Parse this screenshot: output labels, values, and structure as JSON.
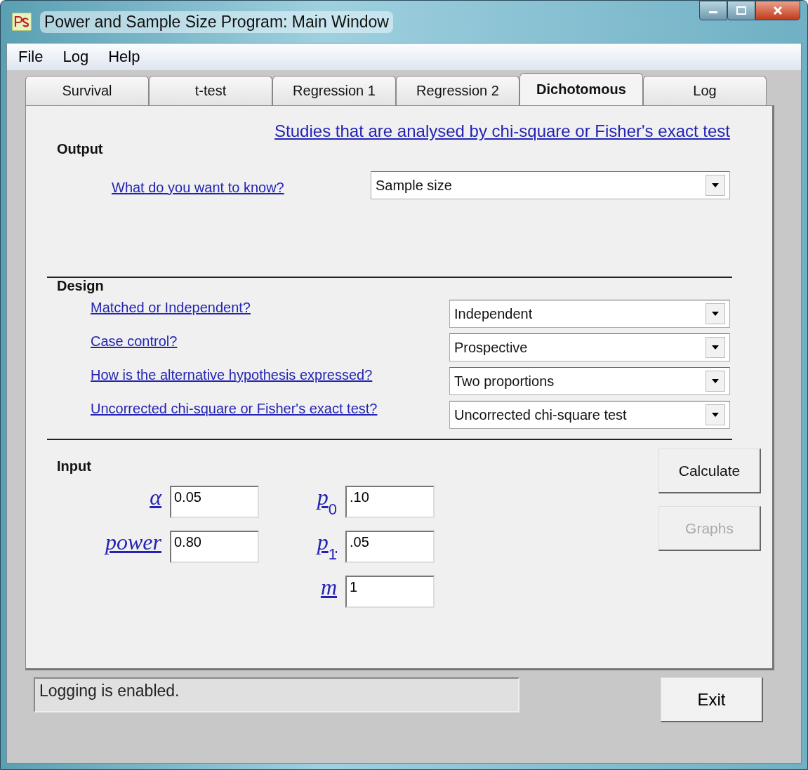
{
  "window": {
    "title": "Power and Sample Size Program:  Main Window"
  },
  "menu": [
    "File",
    "Log",
    "Help"
  ],
  "tabs": [
    {
      "label": "Survival",
      "selected": false
    },
    {
      "label": "t-test",
      "selected": false
    },
    {
      "label": "Regression 1",
      "selected": false
    },
    {
      "label": "Regression 2",
      "selected": false
    },
    {
      "label": "Dichotomous",
      "selected": true
    },
    {
      "label": "Log",
      "selected": false
    }
  ],
  "panel": {
    "title_link": "Studies that are analysed by chi-square or Fisher's exact test",
    "output": {
      "heading": "Output",
      "question": "What do you want to know?",
      "value": "Sample size"
    },
    "design": {
      "heading": "Design",
      "rows": [
        {
          "question": "Matched or Independent?",
          "value": "Independent"
        },
        {
          "question": "Case control?",
          "value": "Prospective"
        },
        {
          "question": "How is the alternative hypothesis expressed?",
          "value": "Two proportions"
        },
        {
          "question": "Uncorrected chi-square or Fisher's exact test?",
          "value": "Uncorrected chi-square test"
        }
      ]
    },
    "input": {
      "heading": "Input",
      "left": [
        {
          "label": "α",
          "value": "0.05"
        },
        {
          "label": "power",
          "value": "0.80"
        }
      ],
      "right": [
        {
          "label": "p$_{0}$",
          "value": ".10"
        },
        {
          "label": "p$_{1}$",
          "value": ".05"
        },
        {
          "label": "m",
          "value": "1"
        }
      ]
    },
    "buttons": [
      {
        "label": "Calculate",
        "disabled": false
      },
      {
        "label": "Graphs",
        "disabled": true
      }
    ]
  },
  "status_bar": "Logging is enabled.",
  "exit_button": "Exit"
}
